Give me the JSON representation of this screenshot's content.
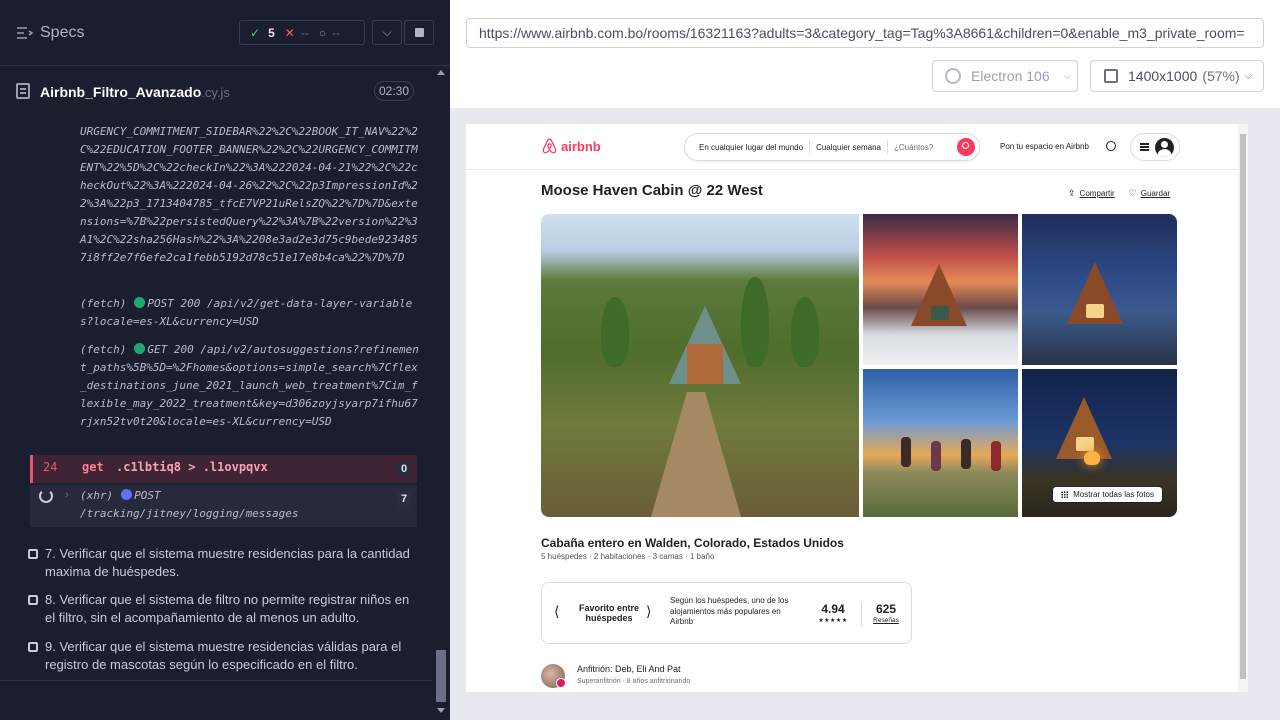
{
  "reporter": {
    "header": {
      "specs_label": "Specs",
      "passed_count": "5",
      "failed_count": "--",
      "pending_count": "--"
    },
    "spec": {
      "name": "Airbnb_Filtro_Avanzado",
      "ext": ".cy.js",
      "duration": "02:30"
    },
    "log": {
      "url_text": "URGENCY_COMMITMENT_SIDEBAR%22%2C%22BOOK_IT_NAV%22%2C%22EDUCATION_FOOTER_BANNER%22%2C%22URGENCY_COMMITMENT%22%5D%2C%22checkIn%22%3A%222024-04-21%22%2C%22checkOut%22%3A%222024-04-26%22%2C%22p3ImpressionId%22%3A%22p3_1713404785_tfcE7VP21uRelsZQ%22%7D%7D&extensions=%7B%22persistedQuery%22%3A%7B%22version%22%3A1%2C%22sha256Hash%22%3A%2208e3ad2e3d75c9bede9234857i8ff2e7f6efe2ca1febb5192d78c51e17e8b4ca%22%7D%7D",
      "fetch1_prefix": "(fetch)",
      "fetch1_text": "POST 200 /api/v2/get-data-layer-variables?locale=es-XL&currency=USD",
      "fetch2_prefix": "(fetch)",
      "fetch2_text": "GET 200 /api/v2/autosuggestions?refinement_paths%5B%5D=%2Fhomes&options=simple_search%7Cflex_destinations_june_2021_launch_web_treatment%7Cim_flexible_may_2022_treatment&key=d306zoyjsyarp7ifhu67rjxn52tv0t20&locale=es-XL&currency=USD",
      "active_command": {
        "number": "24",
        "name": "get",
        "selector": ".c1lbtiq8 > .l1ovpqvx",
        "count": "0"
      },
      "xhr_command": {
        "prefix": "(xhr)",
        "method": "POST",
        "path": "/tracking/jitney/logging/messages",
        "count": "7"
      }
    },
    "tests": [
      "7. Verificar que el sistema muestre residencias para la cantidad maxima de huéspedes.",
      "8. Verificar que el sistema de filtro no permite registrar niños en el filtro, sin el acompañamiento de al menos un adulto.",
      "9. Verificar que el sistema muestre residencias válidas para el registro de mascotas según lo especificado en el filtro."
    ]
  },
  "aut_frame": {
    "url": "https://www.airbnb.com.bo/rooms/16321163?adults=3&category_tag=Tag%3A8661&children=0&enable_m3_private_room=",
    "browser": "Electron 106",
    "viewport": "1400x1000",
    "scale": "(57%)"
  },
  "airbnb": {
    "logo_text": "airbnb",
    "search": {
      "where": "En cualquier lugar del mundo",
      "when": "Cualquier semana",
      "who": "¿Cuántos?"
    },
    "host_link": "Pon tu espacio en Airbnb",
    "listing": {
      "title": "Moose Haven Cabin @ 22 West",
      "share": "Compartir",
      "save": "Guardar",
      "show_all_photos": "Mostrar todas las fotos",
      "subtitle": "Cabaña entero en Walden, Colorado, Estados Unidos",
      "meta": "5 huéspedes · 2 habitaciones · 3 camas · 1 baño",
      "guest_favorite": "Favorito entre huéspedes",
      "guest_favorite_desc": "Según los huéspedes, uno de los alojamientos más populares en Airbnb",
      "rating": "4.94",
      "stars": "★★★★★",
      "reviews_count": "625",
      "reviews_label": "Reseñas",
      "host_name": "Anfitrión: Deb, Eli And Pat",
      "host_sub": "Superanfitrión · 8 años anfitrionando"
    }
  }
}
